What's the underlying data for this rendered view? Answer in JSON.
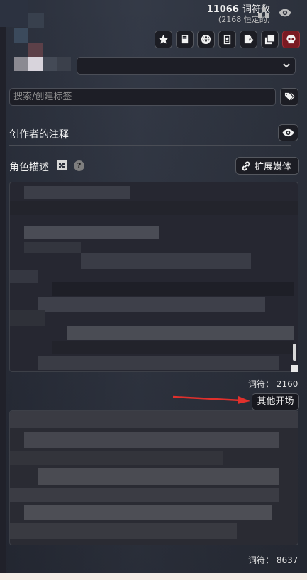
{
  "header": {
    "token_count": "11066",
    "token_label": "词符数",
    "permanent_tokens": "(2168 恒定的)",
    "icons": [
      "stats-icon",
      "eye-icon"
    ]
  },
  "toolbar": {
    "buttons": [
      {
        "name": "favorite-button",
        "icon": "star-icon"
      },
      {
        "name": "lorebook-button",
        "icon": "book-icon"
      },
      {
        "name": "world-info-button",
        "icon": "globe-icon"
      },
      {
        "name": "passport-button",
        "icon": "passport-icon"
      },
      {
        "name": "export-button",
        "icon": "export-icon"
      },
      {
        "name": "duplicate-button",
        "icon": "clone-icon"
      },
      {
        "name": "delete-button",
        "icon": "skull-icon"
      }
    ],
    "danger_color": "#7a1a22"
  },
  "search": {
    "placeholder": "搜索/创建标签"
  },
  "creator_notes": {
    "label": "创作者的注释"
  },
  "description": {
    "label": "角色描述",
    "help": "?",
    "media_button_label": "扩展媒体",
    "token_count": "词符： 2160"
  },
  "first_message": {
    "alt_greetings_label": "其他开场",
    "token_count": "词符： 8637"
  },
  "colors": {
    "accent_arrow": "#e0302c"
  }
}
